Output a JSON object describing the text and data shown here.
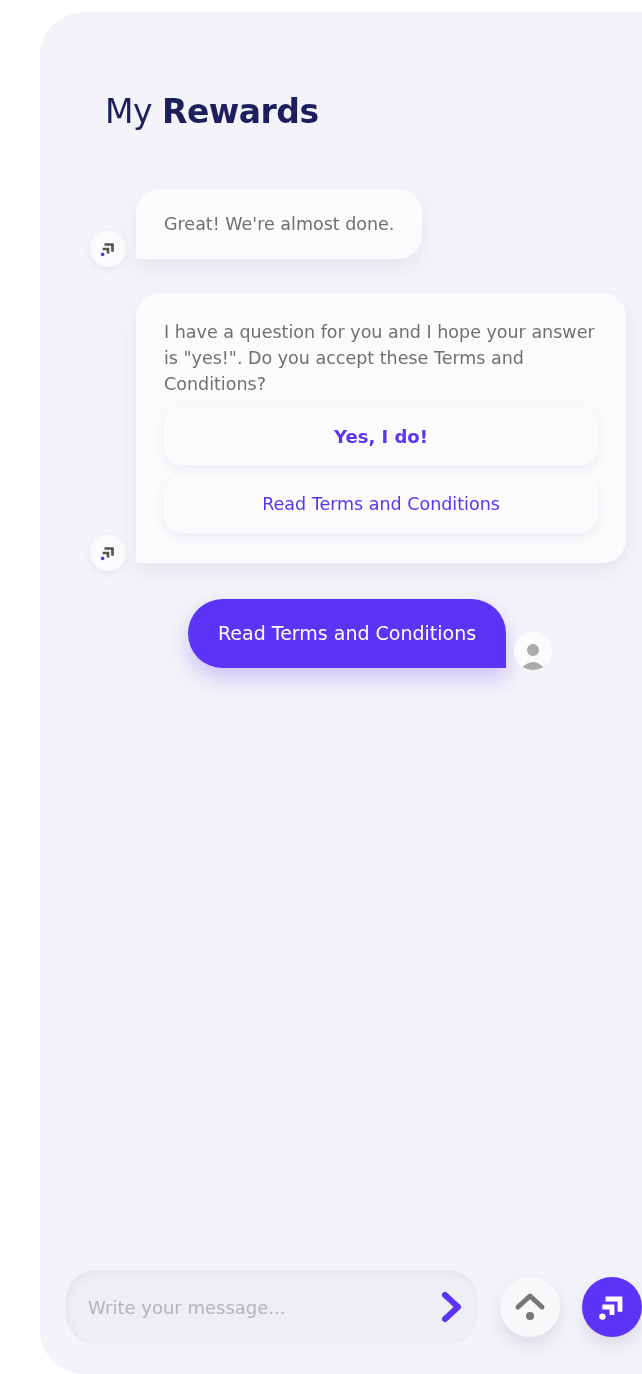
{
  "title": "My **Rewards**",
  "messages": [
    {
      "kind": "bot",
      "text": "Great! We're almost done."
    },
    {
      "kind": "bot",
      "text": "I have a question for you and I hope your answer is \"yes!\". Do you accept these Terms and Conditions?",
      "options": [
        {
          "label": "Yes, I do!",
          "kind": "primary"
        },
        {
          "label": "Read Terms and Conditions",
          "kind": "secondary"
        }
      ]
    },
    {
      "kind": "user",
      "text": "Read Terms and Conditions"
    }
  ],
  "composer": {
    "placeholder": "Write your message..."
  }
}
